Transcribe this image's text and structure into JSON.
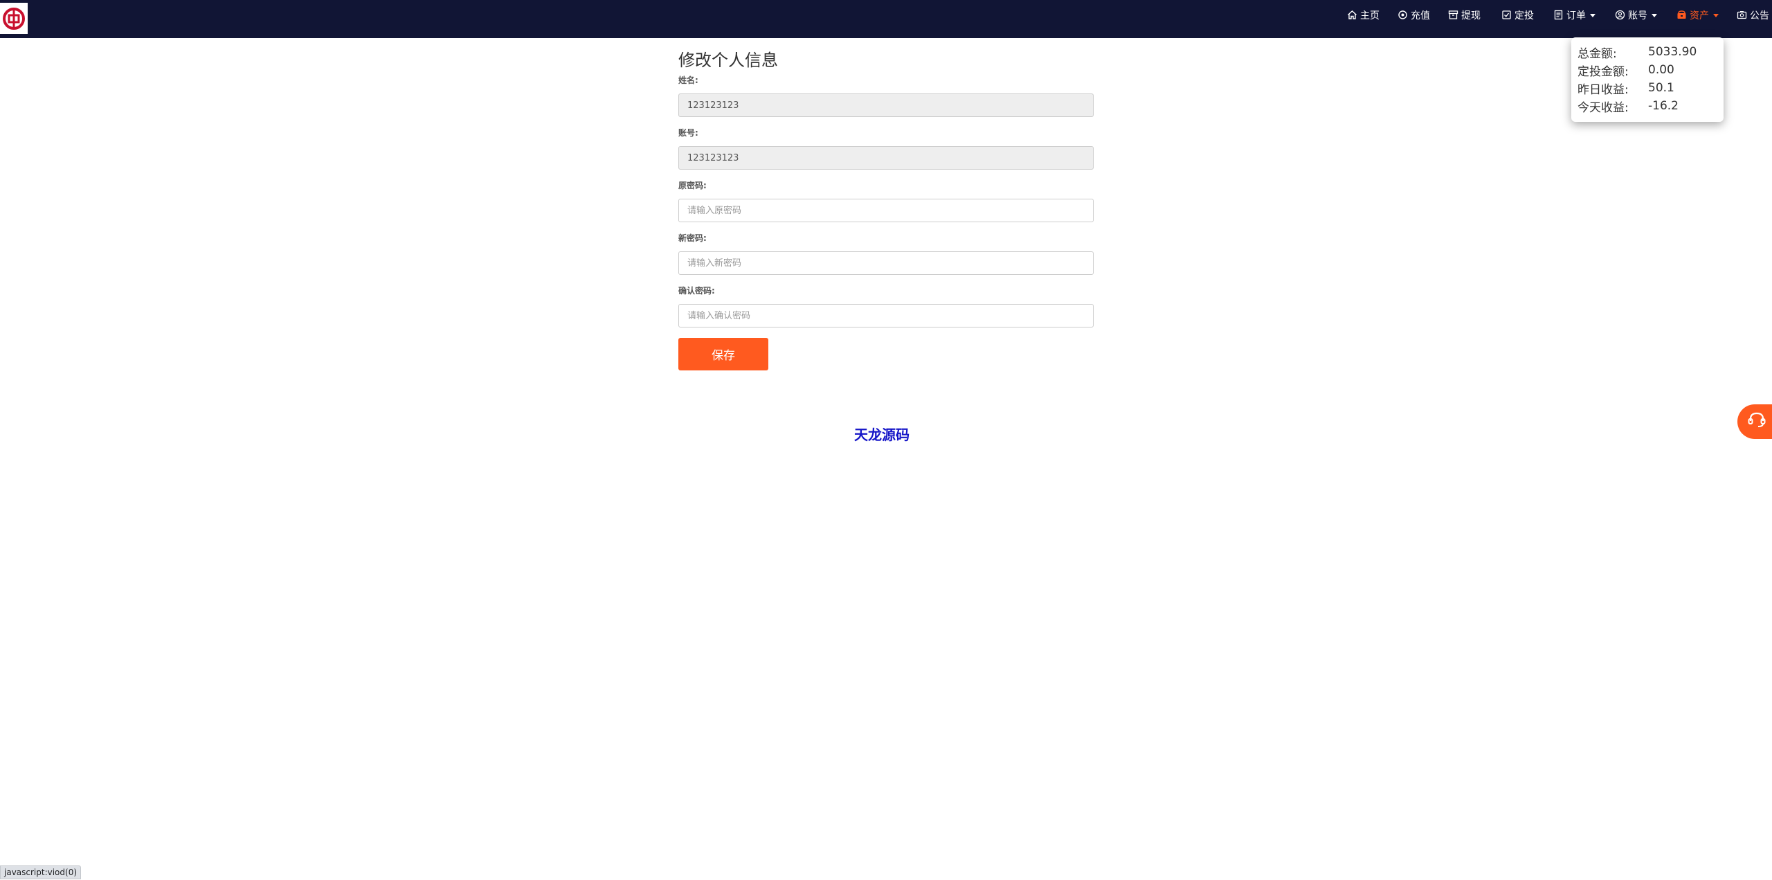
{
  "nav": {
    "items": [
      {
        "id": "home",
        "label": "主页",
        "icon": "home-icon"
      },
      {
        "id": "recharge",
        "label": "充值",
        "icon": "circle-dot-icon"
      },
      {
        "id": "withdraw",
        "label": "提现",
        "icon": "archive-icon"
      },
      {
        "id": "fixed",
        "label": "定投",
        "icon": "checkbox-icon"
      },
      {
        "id": "orders",
        "label": "订单",
        "icon": "document-icon"
      },
      {
        "id": "account",
        "label": "账号",
        "icon": "user-circle-icon"
      },
      {
        "id": "assets",
        "label": "资产",
        "icon": "wallet-icon"
      },
      {
        "id": "notice",
        "label": "公告",
        "icon": "camera-icon"
      }
    ],
    "active": "assets",
    "bg_color": "#111535",
    "active_color": "#ff5a1f"
  },
  "assets": {
    "rows": [
      {
        "label": "总金额:",
        "value": "5033.90"
      },
      {
        "label": "定投金额:",
        "value": "0.00"
      },
      {
        "label": "昨日收益:",
        "value": "50.1"
      },
      {
        "label": "今天收益:",
        "value": "-16.2"
      }
    ]
  },
  "form": {
    "title": "修改个人信息",
    "name_label": "姓名:",
    "name_value": "123123123",
    "account_label": "账号:",
    "account_value": "123123123",
    "old_pw_label": "原密码:",
    "old_pw_placeholder": "请输入原密码",
    "new_pw_label": "新密码:",
    "new_pw_placeholder": "请输入新密码",
    "confirm_pw_label": "确认密码:",
    "confirm_pw_placeholder": "请输入确认密码",
    "save_label": "保存",
    "accent_color": "#ff5a1f"
  },
  "footer": {
    "brand": "天龙源码",
    "brand_color": "#1515c8"
  },
  "cs": {
    "icon": "headset-icon"
  },
  "status_bar": {
    "text": "javascript:viod(0)"
  }
}
